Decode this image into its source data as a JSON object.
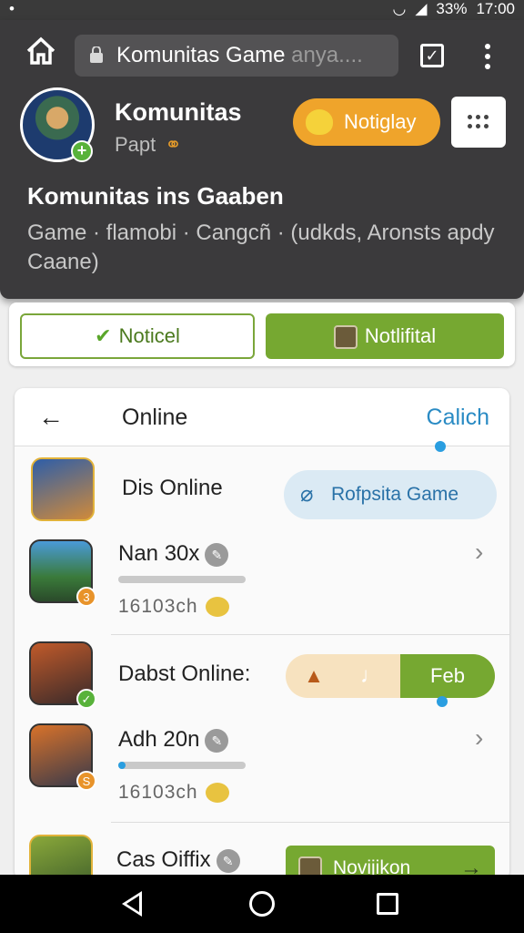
{
  "status_bar": {
    "battery": "33%",
    "time": "17:00"
  },
  "browser": {
    "url_main": "Komunitas Game",
    "url_fade": " anya...."
  },
  "community": {
    "name": "Komunitas",
    "subtitle": "Papt",
    "play_label": "Notiglay",
    "group_title": "Komunitas ins Gaaben",
    "group_desc": "Game · flamobi · Cangcñ · (udkds, Aronsts apdy Caane)"
  },
  "actions": {
    "notice_label": "Noticel",
    "notif_label": "Notlifital"
  },
  "list": {
    "title": "Online",
    "action": "Calich",
    "rows": [
      {
        "name": "Dis Online",
        "pill": "Rofpsita Game"
      },
      {
        "name": "Nan 30x",
        "meta": "16103ch",
        "badge": "3",
        "progress": 0.0
      },
      {
        "name": "Dabst Online:",
        "seg_right": "Feb"
      },
      {
        "name": "Adh 20n",
        "meta": "16103ch",
        "badge": "S",
        "progress": 0.06
      },
      {
        "name": "Cas Oiffix",
        "button": "Novijikon"
      }
    ]
  },
  "colors": {
    "accent_green": "#76a831",
    "accent_orange": "#efa42b",
    "accent_blue": "#2a9ee0",
    "header_dark": "#3b3a3c"
  }
}
